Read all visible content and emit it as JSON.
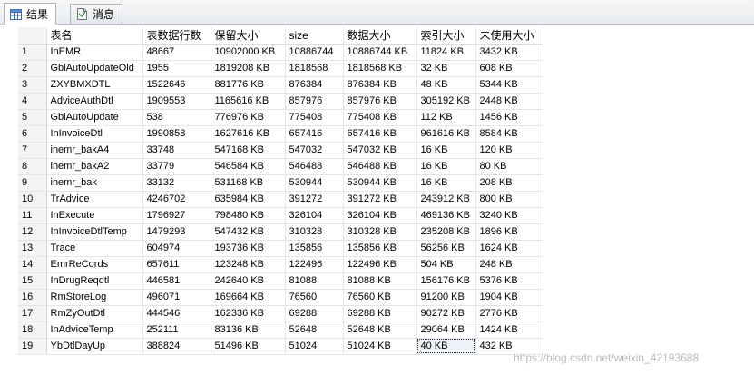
{
  "tabs": [
    {
      "label": "结果",
      "icon": "grid-icon",
      "active": true
    },
    {
      "label": "消息",
      "icon": "message-icon",
      "active": false
    }
  ],
  "columns": [
    "",
    "表名",
    "表数据行数",
    "保留大小",
    "size",
    "数据大小",
    "索引大小",
    "未使用大小"
  ],
  "rows": [
    [
      "1",
      "InEMR",
      "48667",
      "10902000 KB",
      "10886744",
      "10886744 KB",
      "11824 KB",
      "3432 KB"
    ],
    [
      "2",
      "GblAutoUpdateOld",
      "1955",
      "1819208 KB",
      "1818568",
      "1818568 KB",
      "32 KB",
      "608 KB"
    ],
    [
      "3",
      "ZXYBMXDTL",
      "1522646",
      "881776 KB",
      "876384",
      "876384 KB",
      "48 KB",
      "5344 KB"
    ],
    [
      "4",
      "AdviceAuthDtl",
      "1909553",
      "1165616 KB",
      "857976",
      "857976 KB",
      "305192 KB",
      "2448 KB"
    ],
    [
      "5",
      "GblAutoUpdate",
      "538",
      "776976 KB",
      "775408",
      "775408 KB",
      "112 KB",
      "1456 KB"
    ],
    [
      "6",
      "InInvoiceDtl",
      "1990858",
      "1627616 KB",
      "657416",
      "657416 KB",
      "961616 KB",
      "8584 KB"
    ],
    [
      "7",
      "inemr_bakA4",
      "33748",
      "547168 KB",
      "547032",
      "547032 KB",
      "16 KB",
      "120 KB"
    ],
    [
      "8",
      "inemr_bakA2",
      "33779",
      "546584 KB",
      "546488",
      "546488 KB",
      "16 KB",
      "80 KB"
    ],
    [
      "9",
      "inemr_bak",
      "33132",
      "531168 KB",
      "530944",
      "530944 KB",
      "16 KB",
      "208 KB"
    ],
    [
      "10",
      "TrAdvice",
      "4246702",
      "635984 KB",
      "391272",
      "391272 KB",
      "243912 KB",
      "800 KB"
    ],
    [
      "11",
      "InExecute",
      "1796927",
      "798480 KB",
      "326104",
      "326104 KB",
      "469136 KB",
      "3240 KB"
    ],
    [
      "12",
      "InInvoiceDtlTemp",
      "1479293",
      "547432 KB",
      "310328",
      "310328 KB",
      "235208 KB",
      "1896 KB"
    ],
    [
      "13",
      "Trace",
      "604974",
      "193736 KB",
      "135856",
      "135856 KB",
      "56256 KB",
      "1624 KB"
    ],
    [
      "14",
      "EmrReCords",
      "657611",
      "123248 KB",
      "122496",
      "122496 KB",
      "504 KB",
      "248 KB"
    ],
    [
      "15",
      "InDrugReqdtl",
      "446581",
      "242640 KB",
      "81088",
      "81088 KB",
      "156176 KB",
      "5376 KB"
    ],
    [
      "16",
      "RmStoreLog",
      "496071",
      "169664 KB",
      "76560",
      "76560 KB",
      "91200 KB",
      "1904 KB"
    ],
    [
      "17",
      "RmZyOutDtl",
      "444546",
      "162336 KB",
      "69288",
      "69288 KB",
      "90272 KB",
      "2776 KB"
    ],
    [
      "18",
      "InAdviceTemp",
      "252111",
      "83136 KB",
      "52648",
      "52648 KB",
      "29064 KB",
      "1424 KB"
    ],
    [
      "19",
      "YbDtlDayUp",
      "388824",
      "51496 KB",
      "51024",
      "51024 KB",
      "40 KB",
      "432 KB"
    ]
  ],
  "selected_cell": {
    "row": 19,
    "col": 6
  },
  "watermark": "https://blog.csdn.net/weixin_42193688"
}
